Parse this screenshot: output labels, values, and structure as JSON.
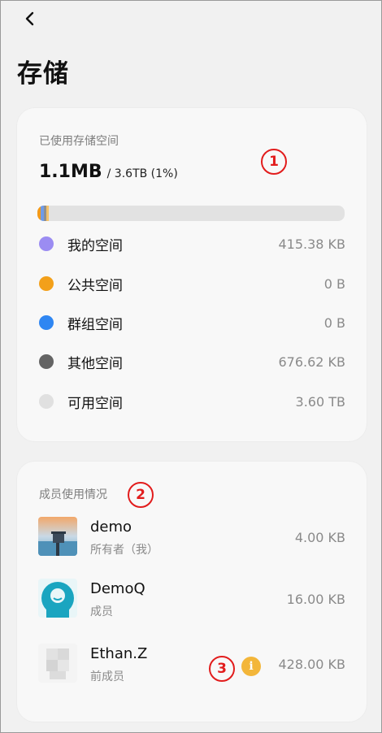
{
  "header": {
    "back_label": "<",
    "title": "存储"
  },
  "storage": {
    "section_label": "已使用存储空间",
    "used": "1.1MB",
    "total": "/ 3.6TB (1%)",
    "usage_percent": 1,
    "bar_colors": [
      "#f39a1a",
      "#6f9be8",
      "#8f8f8f",
      "#f3c16a"
    ],
    "legend": [
      {
        "label": "我的空间",
        "value": "415.38 KB",
        "color": "#9b8cf2"
      },
      {
        "label": "公共空间",
        "value": "0 B",
        "color": "#f3a01a"
      },
      {
        "label": "群组空间",
        "value": "0 B",
        "color": "#2f86f2"
      },
      {
        "label": "其他空间",
        "value": "676.62 KB",
        "color": "#646464"
      },
      {
        "label": "可用空间",
        "value": "3.60 TB",
        "color": "#e0e0e0"
      }
    ]
  },
  "members": {
    "section_label": "成员使用情况",
    "items": [
      {
        "name": "demo",
        "role": "所有者（我）",
        "size": "4.00 KB",
        "avatar": "landscape-avatar"
      },
      {
        "name": "DemoQ",
        "role": "成员",
        "size": "16.00 KB",
        "avatar": "teal-user-avatar"
      },
      {
        "name": "Ethan.Z",
        "role": "前成员",
        "size": "428.00 KB",
        "avatar": "blurred-avatar",
        "info_icon": "i"
      }
    ]
  },
  "annotations": [
    "1",
    "2",
    "3"
  ]
}
